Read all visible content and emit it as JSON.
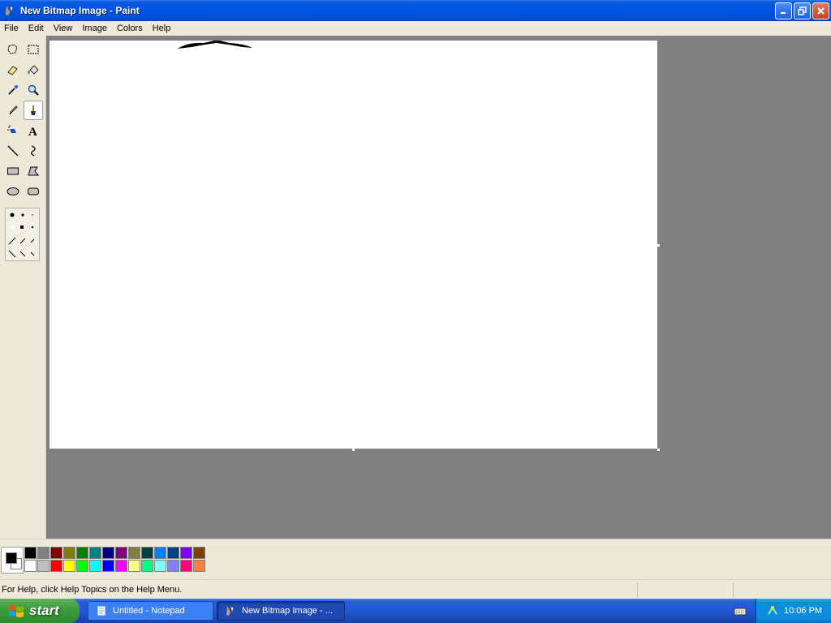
{
  "window": {
    "title": "New Bitmap Image - Paint",
    "icon": "paint-icon"
  },
  "menu": [
    "File",
    "Edit",
    "View",
    "Image",
    "Colors",
    "Help"
  ],
  "tools": [
    "free-form-select-icon",
    "select-icon",
    "eraser-icon",
    "fill-bucket-icon",
    "pick-color-icon",
    "magnifier-icon",
    "pencil-icon",
    "brush-icon",
    "airbrush-icon",
    "text-icon",
    "line-icon",
    "curve-icon",
    "rectangle-icon",
    "polygon-icon",
    "ellipse-icon",
    "rounded-rectangle-icon"
  ],
  "active_tool": "brush-icon",
  "palette": {
    "foreground": "#000000",
    "background": "#ffffff",
    "top_row": [
      "#000000",
      "#808080",
      "#800000",
      "#808000",
      "#008000",
      "#008080",
      "#000080",
      "#800080",
      "#808040",
      "#004040",
      "#0080ff",
      "#004080",
      "#8000ff",
      "#804000"
    ],
    "bottom_row": [
      "#ffffff",
      "#c0c0c0",
      "#ff0000",
      "#ffff00",
      "#00ff00",
      "#00ffff",
      "#0000ff",
      "#ff00ff",
      "#ffff80",
      "#00ff80",
      "#80ffff",
      "#8080ff",
      "#ff0080",
      "#ff8040"
    ]
  },
  "status": {
    "help_text": "For Help, click Help Topics on the Help Menu."
  },
  "taskbar": {
    "start_label": "start",
    "tasks": [
      {
        "label": "Untitled - Notepad",
        "icon": "notepad-icon"
      },
      {
        "label": "New Bitmap Image - ...",
        "icon": "paint-icon"
      }
    ],
    "clock": "10:06 PM"
  }
}
